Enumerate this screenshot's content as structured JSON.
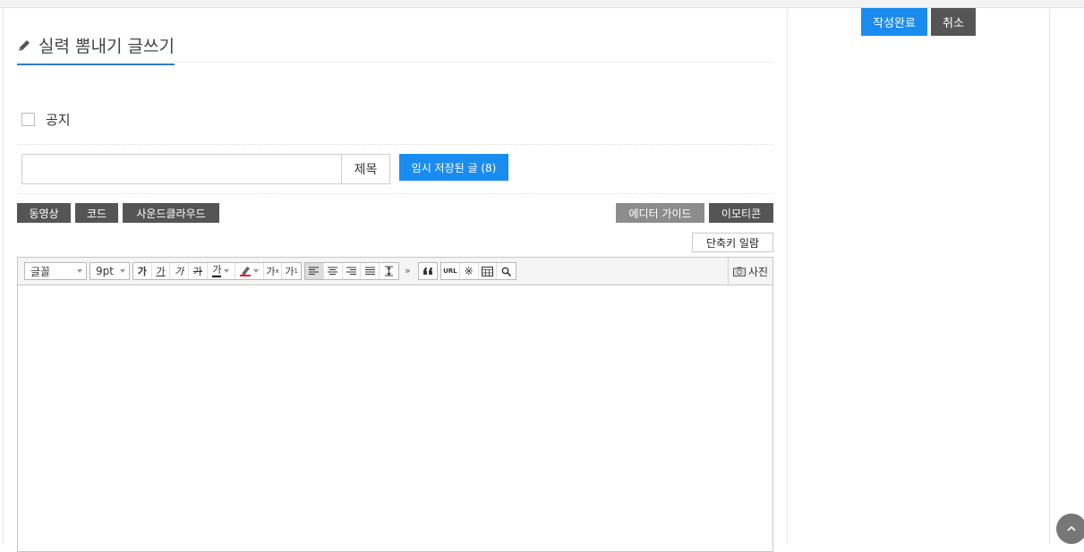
{
  "page": {
    "title": "실력 뽐내기 글쓰기"
  },
  "form": {
    "notice_label": "공지",
    "subject_label": "제목",
    "subject_value": "",
    "temp_saved_label": "임시 저장된 글 (8)"
  },
  "insert_buttons": {
    "video": "동영상",
    "code": "코드",
    "soundcloud": "사운드클라우드",
    "editor_guide": "에디터 가이드",
    "emoticon": "이모티콘",
    "shortcut_list": "단축키 일람"
  },
  "toolbar": {
    "font": "글꼴",
    "size": "9pt",
    "bold": "가",
    "underline": "가",
    "italic": "가",
    "strike": "가",
    "font_color": "가",
    "superscript": "가",
    "subscript": "가",
    "url": "URL",
    "special_char": "※",
    "photo": "사진"
  },
  "actions": {
    "done": "작성완료",
    "cancel": "취소"
  },
  "colors": {
    "primary": "#1a8cf0",
    "dark": "#555555",
    "grey": "#8c8c8c",
    "title_underline": "#2f7bd5"
  }
}
